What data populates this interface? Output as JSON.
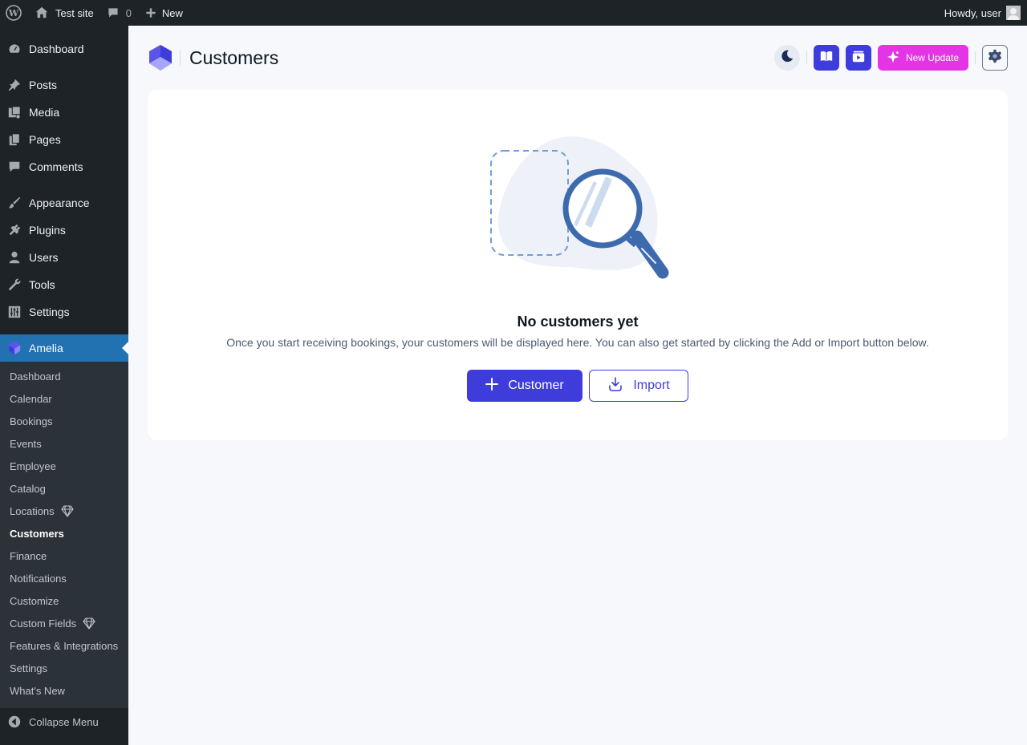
{
  "adminbar": {
    "site_name": "Test site",
    "comments_count": "0",
    "new_label": "New",
    "greeting": "Howdy, user"
  },
  "sidebar": {
    "items": [
      {
        "label": "Dashboard",
        "icon": "dashboard-icon"
      },
      {
        "label": "Posts",
        "icon": "pin-icon"
      },
      {
        "label": "Media",
        "icon": "media-icon"
      },
      {
        "label": "Pages",
        "icon": "pages-icon"
      },
      {
        "label": "Comments",
        "icon": "comment-icon"
      },
      {
        "label": "Appearance",
        "icon": "brush-icon"
      },
      {
        "label": "Plugins",
        "icon": "plugin-icon"
      },
      {
        "label": "Users",
        "icon": "user-icon"
      },
      {
        "label": "Tools",
        "icon": "wrench-icon"
      },
      {
        "label": "Settings",
        "icon": "sliders-icon"
      },
      {
        "label": "Amelia",
        "icon": "amelia-icon"
      }
    ],
    "submenu": [
      {
        "label": "Dashboard"
      },
      {
        "label": "Calendar"
      },
      {
        "label": "Bookings"
      },
      {
        "label": "Events"
      },
      {
        "label": "Employee"
      },
      {
        "label": "Catalog"
      },
      {
        "label": "Locations",
        "badge_icon": "diamond-icon"
      },
      {
        "label": "Customers",
        "current": true
      },
      {
        "label": "Finance"
      },
      {
        "label": "Notifications"
      },
      {
        "label": "Customize"
      },
      {
        "label": "Custom Fields",
        "badge_icon": "diamond-icon"
      },
      {
        "label": "Features & Integrations"
      },
      {
        "label": "Settings"
      },
      {
        "label": "What's New"
      }
    ],
    "collapse_label": "Collapse Menu"
  },
  "header": {
    "title": "Customers",
    "new_update_label": "New Update"
  },
  "empty_state": {
    "title": "No customers yet",
    "description": "Once you start receiving bookings, your customers will be displayed here. You can also get started by clicking the Add or Import button below.",
    "add_label": "Customer",
    "import_label": "Import"
  },
  "colors": {
    "brand": "#3e3ddb",
    "update": "#e534e5",
    "wp_dark": "#1d2327",
    "wp_blue": "#2271b1"
  }
}
